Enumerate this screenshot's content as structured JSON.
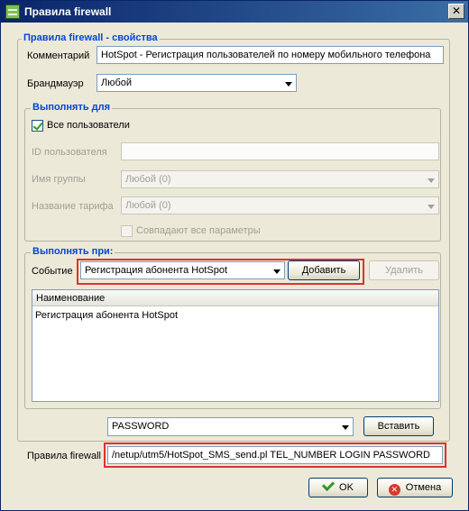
{
  "window": {
    "title": "Правила firewall",
    "close_glyph": "✕"
  },
  "properties_group": {
    "title": "Правила firewall - свойства",
    "comment_label": "Комментарий",
    "comment_value": "HotSpot - Регистрация пользователей по номеру мобильного телефона",
    "firewall_label": "Брандмауэр",
    "firewall_value": "Любой"
  },
  "execute_for_group": {
    "title": "Выполнять для",
    "all_users_label": "Все пользователи",
    "all_users_checked": true,
    "user_id_label": "ID пользователя",
    "user_id_value": "",
    "group_name_label": "Имя группы",
    "group_name_value": "Любой (0)",
    "tariff_name_label": "Название тарифа",
    "tariff_name_value": "Любой (0)",
    "match_all_label": "Совпадают все параметры"
  },
  "execute_on_group": {
    "title": "Выполнять при:",
    "event_label": "Событие",
    "event_value": "Регистрация абонента HotSpot",
    "add_button": "Добавить",
    "delete_button": "Удалить",
    "table": {
      "column_header": "Наименование",
      "rows": [
        "Регистрация абонента HotSpot"
      ]
    }
  },
  "variable_select": {
    "value": "PASSWORD",
    "insert_button": "Вставить"
  },
  "firewall_rule": {
    "label": "Правила firewall",
    "value": "/netup/utm5/HotSpot_SMS_send.pl TEL_NUMBER LOGIN PASSWORD"
  },
  "footer": {
    "ok_button": "OK",
    "cancel_button": "Отмена",
    "cancel_glyph": "✕"
  },
  "colors": {
    "title_bar": "#0a246a",
    "group_title": "#0046d5",
    "highlight": "#e03030"
  }
}
